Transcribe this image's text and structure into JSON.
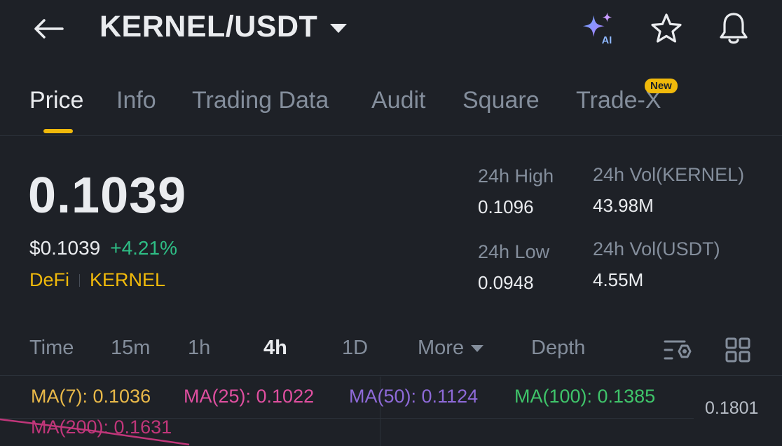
{
  "header": {
    "pair": "KERNEL/USDT",
    "icons": {
      "back": "arrow-left-icon",
      "ai": "ai-sparkle-icon",
      "favorite": "star-icon",
      "alert": "bell-icon"
    },
    "ai_label": "AI"
  },
  "tabs": [
    {
      "label": "Price",
      "active": true
    },
    {
      "label": "Info"
    },
    {
      "label": "Trading Data"
    },
    {
      "label": "Audit"
    },
    {
      "label": "Square"
    },
    {
      "label": "Trade-X",
      "badge": "New"
    }
  ],
  "ticker": {
    "last_price": "0.1039",
    "fiat_price": "$0.1039",
    "change_pct": "+4.21%",
    "tags": [
      "DeFi",
      "KERNEL"
    ],
    "stats": {
      "high_label": "24h High",
      "high_value": "0.1096",
      "low_label": "24h Low",
      "low_value": "0.0948",
      "vol_base_label": "24h Vol(KERNEL)",
      "vol_base_value": "43.98M",
      "vol_quote_label": "24h Vol(USDT)",
      "vol_quote_value": "4.55M"
    }
  },
  "intervals": {
    "items": [
      "Time",
      "15m",
      "1h",
      "4h",
      "1D"
    ],
    "selected": "4h",
    "more_label": "More",
    "depth_label": "Depth",
    "icons": {
      "indicator_settings": "chart-settings-icon",
      "layout": "grid-layout-icon"
    }
  },
  "indicators": {
    "ma7": "MA(7): 0.1036",
    "ma25": "MA(25): 0.1022",
    "ma50": "MA(50): 0.1124",
    "ma100": "MA(100): 0.1385",
    "ma200": "MA(200): 0.1631",
    "axis_price": "0.1801"
  },
  "colors": {
    "accent": "#f0b90b",
    "up": "#2ebd85",
    "ma7": "#e9b949",
    "ma25": "#e04fa0",
    "ma50": "#8e6ad8",
    "ma100": "#3fc46a",
    "ma200": "#c0367a"
  }
}
